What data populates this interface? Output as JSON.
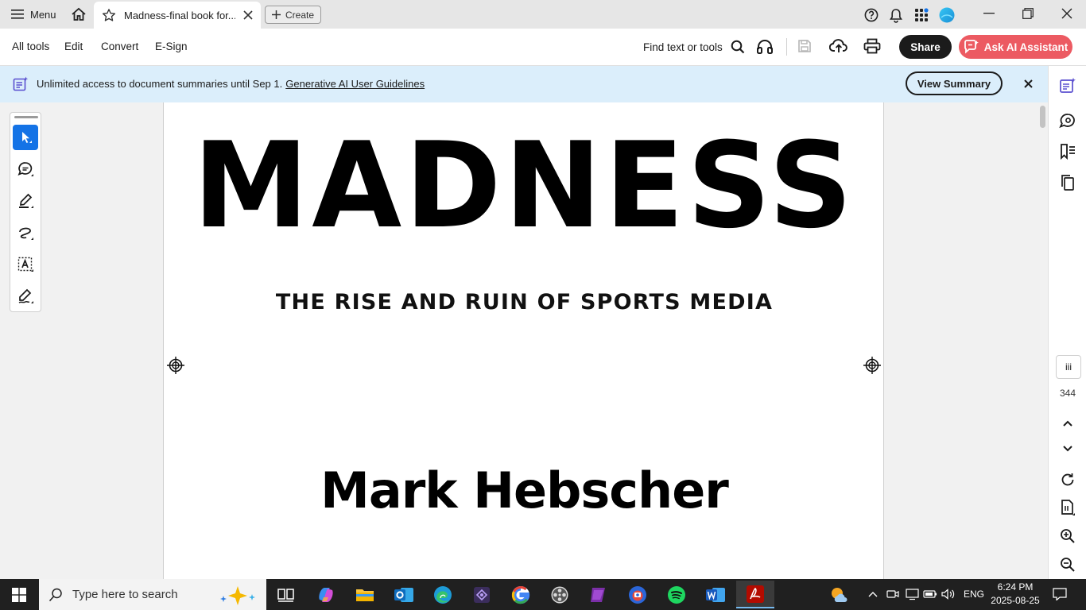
{
  "titlebar": {
    "menu_label": "Menu",
    "tab_title": "Madness-final book for...",
    "create_label": "Create"
  },
  "toolbar": {
    "items": [
      "All tools",
      "Edit",
      "Convert",
      "E-Sign"
    ],
    "find_label": "Find text or tools",
    "share_label": "Share",
    "ai_label": "Ask AI Assistant"
  },
  "banner": {
    "text": "Unlimited access to document summaries until Sep 1.",
    "link": "Generative AI User Guidelines",
    "button": "View Summary"
  },
  "document": {
    "title": "MADNESS",
    "subtitle": "THE RISE AND RUIN OF SPORTS MEDIA",
    "author": "Mark Hebscher"
  },
  "navigation": {
    "current_page": "iii",
    "total_pages": "344"
  },
  "taskbar": {
    "search_placeholder": "Type here to search",
    "language": "ENG",
    "time": "6:24 PM",
    "date": "2025-08-25"
  },
  "colors": {
    "accent_blue": "#1473e6",
    "ai_button": "#ec5a62",
    "banner_bg": "#dbeefb",
    "taskbar_bg": "#202020"
  }
}
